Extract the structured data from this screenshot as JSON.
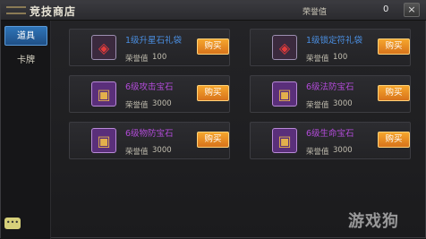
{
  "window": {
    "title": "竞技商店",
    "close_label": "×"
  },
  "currency": {
    "label": "荣誉值",
    "value": "0"
  },
  "sidebar": {
    "tabs": [
      {
        "label": "道具",
        "active": true
      },
      {
        "label": "卡牌",
        "active": false
      }
    ],
    "chat_icon": "chat-bubble-icon"
  },
  "shop": {
    "price_label": "荣誉值",
    "buy_label": "购买",
    "items": [
      {
        "name": "1级升星石礼袋",
        "price": "100",
        "icon": "gift-bag-icon",
        "rarity_color": "#4a8ee0"
      },
      {
        "name": "1级锁定符礼袋",
        "price": "100",
        "icon": "gift-bag-icon",
        "rarity_color": "#4a8ee0"
      },
      {
        "name": "6级攻击宝石",
        "price": "3000",
        "icon": "treasure-chest-icon",
        "rarity_color": "#b24bd9"
      },
      {
        "name": "6级法防宝石",
        "price": "3000",
        "icon": "treasure-chest-icon",
        "rarity_color": "#b24bd9"
      },
      {
        "name": "6级物防宝石",
        "price": "3000",
        "icon": "treasure-chest-icon",
        "rarity_color": "#b24bd9"
      },
      {
        "name": "6级生命宝石",
        "price": "3000",
        "icon": "treasure-chest-icon",
        "rarity_color": "#b24bd9"
      }
    ]
  },
  "watermark": "游戏狗"
}
